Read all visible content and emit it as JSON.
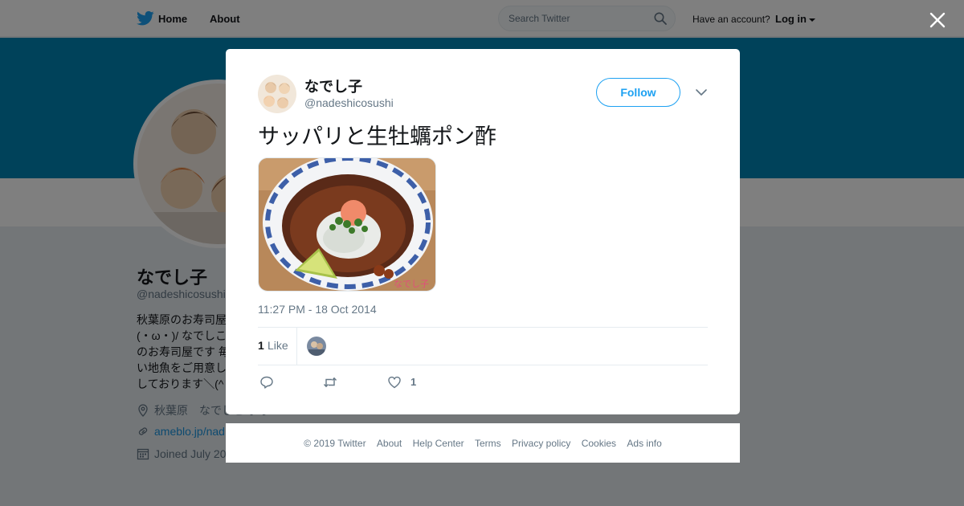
{
  "nav": {
    "home": "Home",
    "about": "About",
    "search_placeholder": "Search Twitter",
    "have_account": "Have an account?",
    "login": "Log in"
  },
  "profile": {
    "name": "なでし子",
    "handle": "@nadeshicosushi",
    "bio_lines": [
      "秋葉原のお寿司屋",
      "(・ω・)/ なでしこ",
      "のお寿司屋です 毎",
      "い地魚をご用意し",
      "しております＼(^"
    ],
    "location": "秋葉原　なでしこ寿司",
    "website": "ameblo.jp/nad",
    "joined": "Joined July 20"
  },
  "tweet": {
    "name": "なでし子",
    "handle": "@nadeshicosushi",
    "follow_label": "Follow",
    "text": "サッパリと生牡蠣ポン酢",
    "timestamp": "11:27 PM - 18 Oct 2014",
    "like_stat_count": "1",
    "like_stat_label": "Like",
    "like_action_count": "1"
  },
  "footer": {
    "copyright": "© 2019 Twitter",
    "about": "About",
    "help_center": "Help Center",
    "terms": "Terms",
    "privacy": "Privacy policy",
    "cookies": "Cookies",
    "ads_info": "Ads info"
  },
  "icons": {
    "logo": "twitter-bird-icon",
    "search": "search-icon",
    "close": "close-icon",
    "caret": "chevron-down-icon",
    "reply": "reply-icon",
    "retweet": "retweet-icon",
    "like": "heart-icon",
    "location": "location-pin-icon",
    "link": "link-icon",
    "calendar": "calendar-icon"
  },
  "colors": {
    "brand": "#1da1f2",
    "banner": "#0084b4",
    "text_secondary": "#657786"
  }
}
